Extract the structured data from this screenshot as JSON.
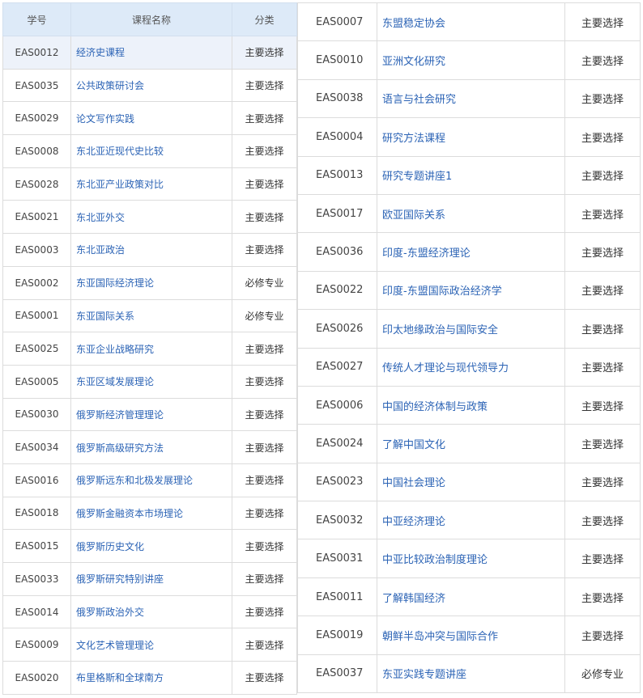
{
  "headers": {
    "id": "学号",
    "name": "课程名称",
    "category": "分类"
  },
  "left_rows": [
    {
      "id": "EAS0012",
      "name": "经济史课程",
      "category": "主要选择"
    },
    {
      "id": "EAS0035",
      "name": "公共政策研讨会",
      "category": "主要选择"
    },
    {
      "id": "EAS0029",
      "name": "论文写作实践",
      "category": "主要选择"
    },
    {
      "id": "EAS0008",
      "name": "东北亚近现代史比较",
      "category": "主要选择"
    },
    {
      "id": "EAS0028",
      "name": "东北亚产业政策对比",
      "category": "主要选择"
    },
    {
      "id": "EAS0021",
      "name": "东北亚外交",
      "category": "主要选择"
    },
    {
      "id": "EAS0003",
      "name": "东北亚政治",
      "category": "主要选择"
    },
    {
      "id": "EAS0002",
      "name": "东亚国际经济理论",
      "category": "必修专业"
    },
    {
      "id": "EAS0001",
      "name": "东亚国际关系",
      "category": "必修专业"
    },
    {
      "id": "EAS0025",
      "name": "东亚企业战略研究",
      "category": "主要选择"
    },
    {
      "id": "EAS0005",
      "name": "东亚区域发展理论",
      "category": "主要选择"
    },
    {
      "id": "EAS0030",
      "name": "俄罗斯经济管理理论",
      "category": "主要选择"
    },
    {
      "id": "EAS0034",
      "name": "俄罗斯高级研究方法",
      "category": "主要选择"
    },
    {
      "id": "EAS0016",
      "name": "俄罗斯远东和北极发展理论",
      "category": "主要选择"
    },
    {
      "id": "EAS0018",
      "name": "俄罗斯金融资本市场理论",
      "category": "主要选择"
    },
    {
      "id": "EAS0015",
      "name": "俄罗斯历史文化",
      "category": "主要选择"
    },
    {
      "id": "EAS0033",
      "name": "俄罗斯研究特别讲座",
      "category": "主要选择"
    },
    {
      "id": "EAS0014",
      "name": "俄罗斯政治外交",
      "category": "主要选择"
    },
    {
      "id": "EAS0009",
      "name": "文化艺术管理理论",
      "category": "主要选择"
    },
    {
      "id": "EAS0020",
      "name": "布里格斯和全球南方",
      "category": "主要选择"
    }
  ],
  "right_rows": [
    {
      "id": "EAS0007",
      "name": "东盟稳定协会",
      "category": "主要选择"
    },
    {
      "id": "EAS0010",
      "name": "亚洲文化研究",
      "category": "主要选择"
    },
    {
      "id": "EAS0038",
      "name": "语言与社会研究",
      "category": "主要选择"
    },
    {
      "id": "EAS0004",
      "name": "研究方法课程",
      "category": "主要选择"
    },
    {
      "id": "EAS0013",
      "name": "研究专题讲座1",
      "category": "主要选择"
    },
    {
      "id": "EAS0017",
      "name": "欧亚国际关系",
      "category": "主要选择"
    },
    {
      "id": "EAS0036",
      "name": "印度-东盟经济理论",
      "category": "主要选择"
    },
    {
      "id": "EAS0022",
      "name": "印度-东盟国际政治经济学",
      "category": "主要选择"
    },
    {
      "id": "EAS0026",
      "name": "印太地缘政治与国际安全",
      "category": "主要选择"
    },
    {
      "id": "EAS0027",
      "name": "传统人才理论与现代领导力",
      "category": "主要选择"
    },
    {
      "id": "EAS0006",
      "name": "中国的经济体制与政策",
      "category": "主要选择"
    },
    {
      "id": "EAS0024",
      "name": "了解中国文化",
      "category": "主要选择"
    },
    {
      "id": "EAS0023",
      "name": "中国社会理论",
      "category": "主要选择"
    },
    {
      "id": "EAS0032",
      "name": "中亚经济理论",
      "category": "主要选择"
    },
    {
      "id": "EAS0031",
      "name": "中亚比较政治制度理论",
      "category": "主要选择"
    },
    {
      "id": "EAS0011",
      "name": "了解韩国经济",
      "category": "主要选择"
    },
    {
      "id": "EAS0019",
      "name": "朝鲜半岛冲突与国际合作",
      "category": "主要选择"
    },
    {
      "id": "EAS0037",
      "name": "东亚实践专题讲座",
      "category": "必修专业"
    }
  ],
  "colors": {
    "header_bg": "#ddeaf8",
    "link": "#2b63b5",
    "highlight_row": "#edf2fa"
  }
}
